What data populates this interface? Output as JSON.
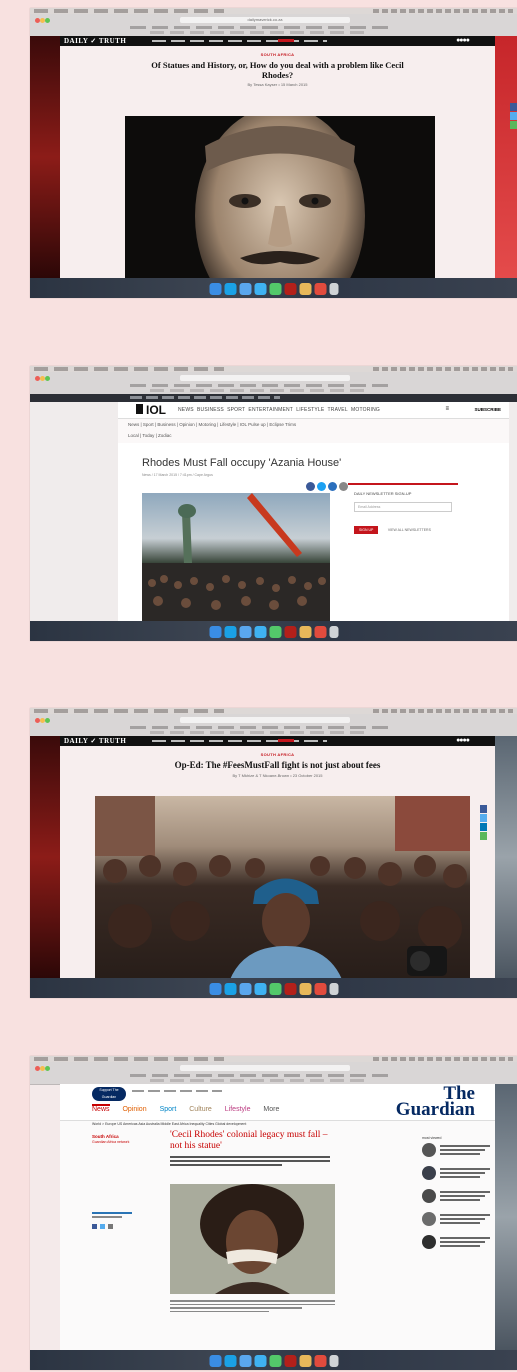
{
  "screenshot1": {
    "site_logo": "DAILY ✓ TRUTH",
    "section": "SOUTH AFRICA",
    "headline": "Of Statues and History, or, How do you deal with a problem like Cecil Rhodes?",
    "byline": "By Tessa Kayser • 15 March 2015",
    "url": "dailymaverick.co.za"
  },
  "screenshot2": {
    "site_logo": "IOL",
    "nav": [
      "NEWS",
      "BUSINESS",
      "SPORT",
      "ENTERTAINMENT",
      "LIFESTYLE",
      "TRAVEL",
      "MOTORING"
    ],
    "subscribe": "SUBSCRIBE",
    "sub_nav": "News | Sport | Business | Opinion | Motoring | Lifestyle | IOL Pulse up | Eclipse Trims",
    "breadcrumb": "Local | Today | Zodiac",
    "headline": "Rhodes Must Fall occupy 'Azania House'",
    "meta": "News / 17 March 2015 / 7:41pm / Cape Argus",
    "caption": "Cape Argus",
    "newsletter_heading": "DAILY NEWSLETTER SIGN-UP",
    "newsletter_placeholder": "Email Address",
    "signup_button": "SIGN UP",
    "all_newsletters": "VIEW ALL NEWSLETTERS"
  },
  "screenshot3": {
    "site_logo": "DAILY ✓ TRUTH",
    "section": "SOUTH AFRICA",
    "headline": "Op-Ed: The #FeesMustFall fight is not just about fees",
    "byline": "By T Mkhize & T Nkoane-Brown • 23 October 2015"
  },
  "screenshot4": {
    "logo_line1": "The",
    "logo_line2": "Guardian",
    "support_badge": "Support The Guardian",
    "nav": [
      "News",
      "Opinion",
      "Sport",
      "Culture",
      "Lifestyle",
      "More"
    ],
    "sub_nav": "World > Europe US Americas Asia Australia Middle East Africa Inequality Cities Global development",
    "section": "South Africa",
    "section_sub": "Guardian Africa network",
    "headline": "'Cecil Rhodes' colonial legacy must fall – not his statue'",
    "most_viewed_label": "most viewed",
    "colors": {
      "guardian_blue": "#052962",
      "guardian_red": "#c70000"
    }
  },
  "dock_icons": [
    "finder-icon",
    "skype-icon",
    "trash-icon"
  ]
}
